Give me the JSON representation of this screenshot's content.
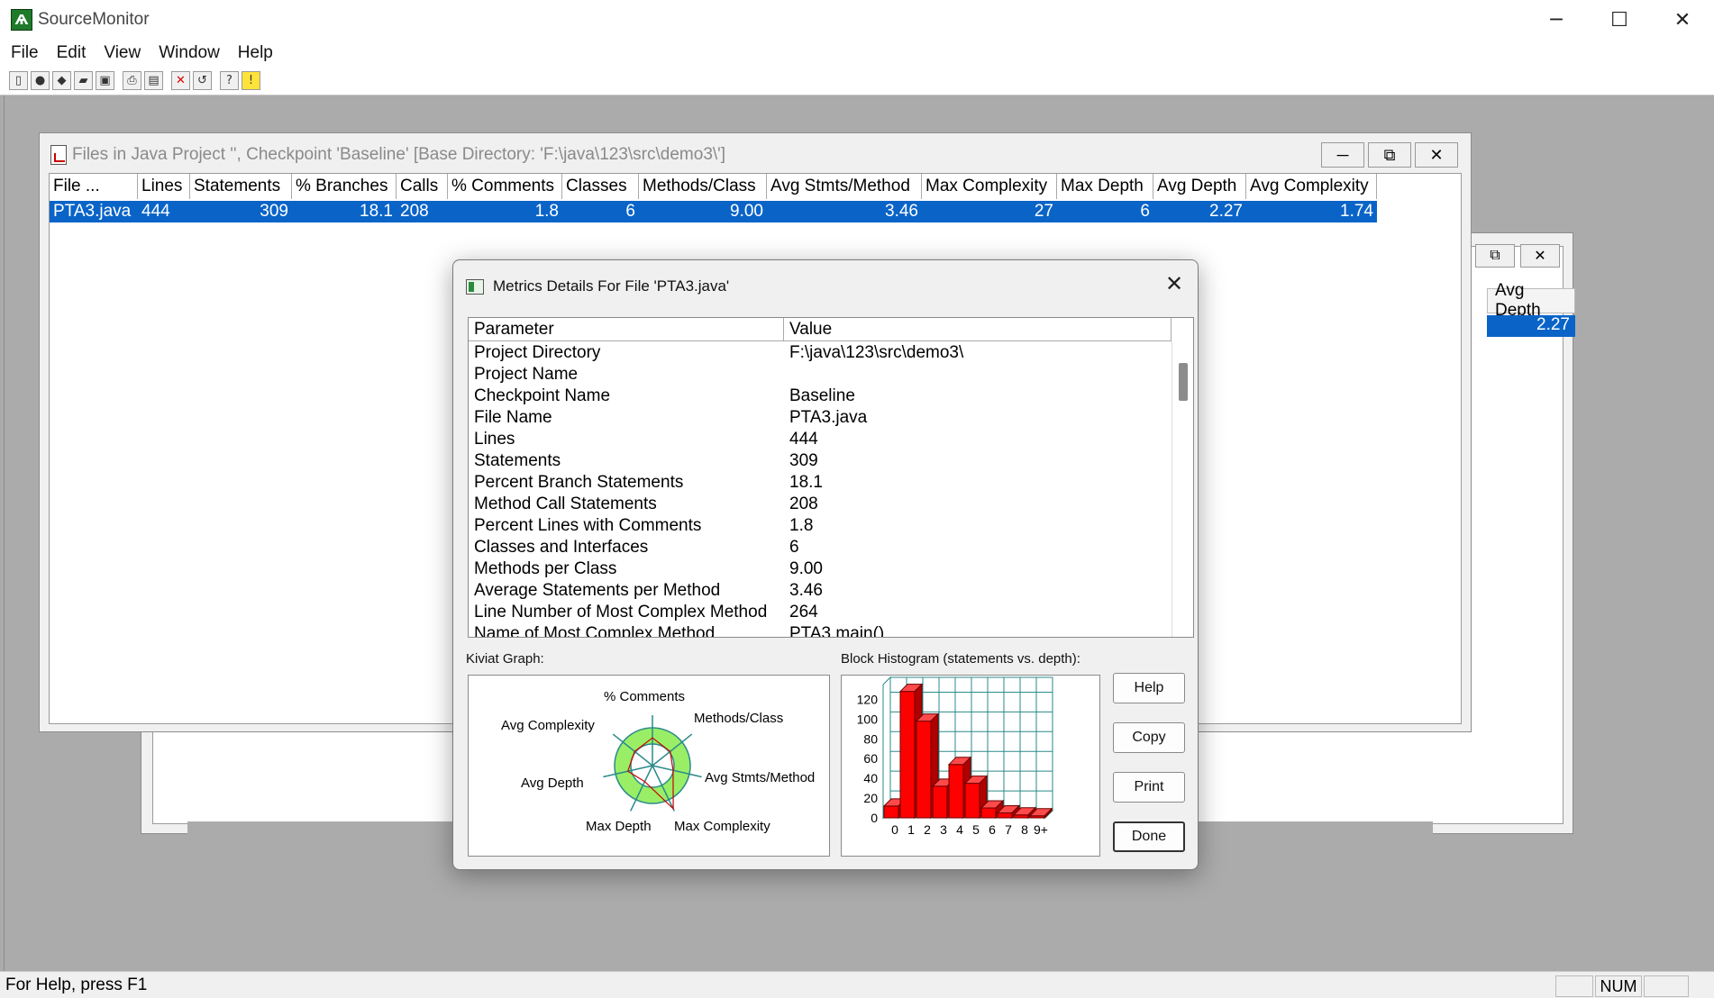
{
  "app": {
    "title": "SourceMonitor",
    "icon": "source-monitor-logo-icon",
    "window_controls": [
      "minimize-icon",
      "maximize-icon",
      "close-icon"
    ]
  },
  "menu": [
    "File",
    "Edit",
    "View",
    "Window",
    "Help"
  ],
  "toolbar_icons": [
    "new-icon",
    "open-checkpoint-icon",
    "checkpoint-icon",
    "open-folder-icon",
    "save-icon",
    "print-icon",
    "print-preview-icon",
    "delete-icon",
    "refresh-icon",
    "help-cursor-icon",
    "about-icon"
  ],
  "back_window": {
    "header": "Avg Depth",
    "cell": "2.27"
  },
  "files_window": {
    "title": "Files in Java Project '', Checkpoint 'Baseline'  [Base Directory: 'F:\\java\\123\\src\\demo3\\']",
    "columns": [
      "File ...",
      "Lines",
      "Statements",
      "% Branches",
      "Calls",
      "% Comments",
      "Classes",
      "Methods/Class",
      "Avg Stmts/Method",
      "Max Complexity",
      "Max Depth",
      "Avg Depth",
      "Avg Complexity"
    ],
    "rows": [
      [
        "PTA3.java",
        "444",
        "309",
        "18.1",
        "208",
        "1.8",
        "6",
        "9.00",
        "3.46",
        "27",
        "6",
        "2.27",
        "1.74"
      ]
    ]
  },
  "dialog": {
    "title": "Metrics Details For File 'PTA3.java'",
    "param_header": "Parameter",
    "value_header": "Value",
    "rows": [
      [
        "Project Directory",
        "F:\\java\\123\\src\\demo3\\"
      ],
      [
        "Project Name",
        ""
      ],
      [
        "Checkpoint Name",
        "Baseline"
      ],
      [
        "File Name",
        "PTA3.java"
      ],
      [
        "Lines",
        "444"
      ],
      [
        "Statements",
        "309"
      ],
      [
        "Percent Branch Statements",
        "18.1"
      ],
      [
        "Method Call Statements",
        "208"
      ],
      [
        "Percent Lines with Comments",
        "1.8"
      ],
      [
        "Classes and Interfaces",
        "6"
      ],
      [
        "Methods per Class",
        "9.00"
      ],
      [
        "Average Statements per Method",
        "3.46"
      ],
      [
        "Line Number of Most Complex Method",
        "264"
      ],
      [
        "Name of Most Complex Method",
        "PTA3.main()"
      ]
    ],
    "kiviat_label": "Kiviat Graph:",
    "histogram_label": "Block Histogram (statements vs. depth):",
    "buttons": {
      "help": "Help",
      "copy": "Copy",
      "print": "Print",
      "done": "Done"
    },
    "kiviat_axes": [
      "% Comments",
      "Methods/Class",
      "Avg Stmts/Method",
      "Max Complexity",
      "Max Depth",
      "Avg Depth",
      "Avg Complexity"
    ]
  },
  "chart_data": {
    "type": "bar",
    "title": "",
    "categories": [
      "0",
      "1",
      "2",
      "3",
      "4",
      "5",
      "6",
      "7",
      "8",
      "9+"
    ],
    "values": [
      12,
      128,
      98,
      32,
      54,
      35,
      10,
      5,
      3,
      2
    ],
    "ylim": [
      0,
      135
    ],
    "yticks": [
      "0",
      "20",
      "40",
      "60",
      "80",
      "100",
      "120"
    ],
    "grid": true,
    "bar_color": "#ff0000"
  },
  "status": {
    "help_text": "For Help, press F1",
    "num": "NUM"
  },
  "colors": {
    "selection": "#0a64c8",
    "kiviat_fill": "#99ee66",
    "histogram_bar": "#ff0000",
    "histogram_grid": "#2a8a8a"
  }
}
